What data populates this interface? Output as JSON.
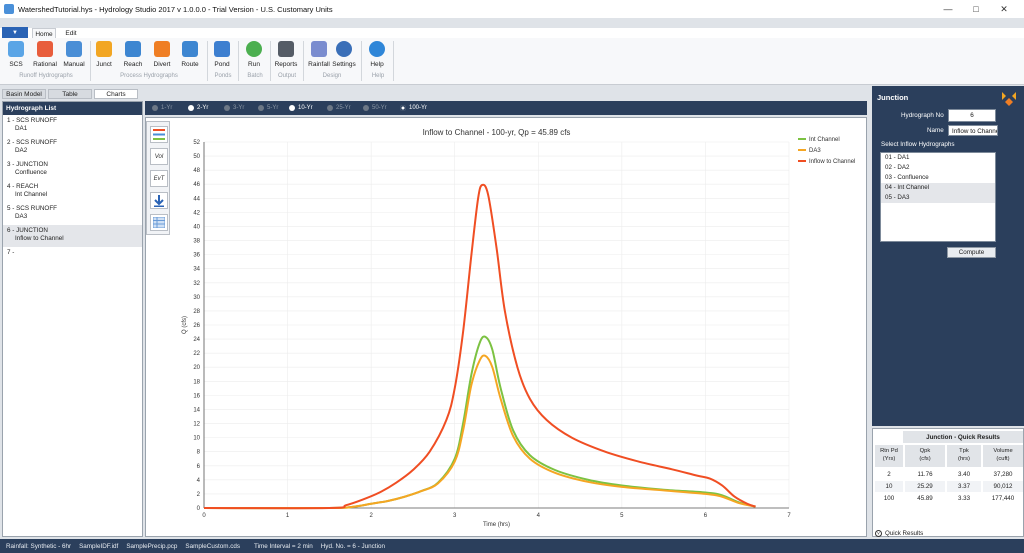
{
  "window": {
    "title": "WatershedTutorial.hys - Hydrology Studio 2017 v 1.0.0.0 - Trial Version - U.S. Customary Units"
  },
  "menu": {
    "tabs": [
      "Home",
      "Edit"
    ]
  },
  "ribbon": {
    "buttons": [
      {
        "label": "SCS",
        "icon": "scs-rain-icon"
      },
      {
        "label": "Rational",
        "icon": "rational-icon"
      },
      {
        "label": "Manual",
        "icon": "manual-icon"
      },
      {
        "label": "Junct",
        "icon": "junction-icon"
      },
      {
        "label": "Reach",
        "icon": "reach-icon"
      },
      {
        "label": "Divert",
        "icon": "divert-icon"
      },
      {
        "label": "Route",
        "icon": "route-icon"
      },
      {
        "label": "Pond",
        "icon": "pond-icon"
      },
      {
        "label": "Run",
        "icon": "run-icon"
      },
      {
        "label": "Reports",
        "icon": "printer-icon"
      },
      {
        "label": "Rainfall",
        "icon": "rainfall-icon"
      },
      {
        "label": "Settings",
        "icon": "gear-icon"
      },
      {
        "label": "Help",
        "icon": "help-icon"
      }
    ],
    "groups": [
      "Runoff Hydrographs",
      "Process Hydrographs",
      "Ponds",
      "Batch",
      "Output",
      "Design",
      "Help"
    ]
  },
  "views": {
    "tabs": [
      "Basin Model",
      "Table",
      "Charts"
    ],
    "active": "Charts"
  },
  "hydrograph_list": {
    "title": "Hydrograph List",
    "items": [
      {
        "line1": "1 - SCS RUNOFF",
        "line2": "DA1"
      },
      {
        "line1": "2 - SCS RUNOFF",
        "line2": "DA2"
      },
      {
        "line1": "3 - JUNCTION",
        "line2": "Confluence"
      },
      {
        "line1": "4 - REACH",
        "line2": "Int Channel"
      },
      {
        "line1": "5 - SCS RUNOFF",
        "line2": "DA3"
      },
      {
        "line1": "6 - JUNCTION",
        "line2": "Inflow to Channel"
      },
      {
        "line1": "7 -",
        "line2": ""
      }
    ],
    "selected_index": 5
  },
  "return_periods": {
    "options": [
      "1-Yr",
      "2-Yr",
      "3-Yr",
      "5-Yr",
      "10-Yr",
      "25-Yr",
      "50-Yr",
      "100-Yr"
    ],
    "enabled": [
      "2-Yr",
      "10-Yr",
      "100-Yr"
    ],
    "selected": "100-Yr"
  },
  "chart_tools": {
    "vol_label": "Vol",
    "evt_label": "EvT"
  },
  "chart_data": {
    "type": "line",
    "title": "Inflow to Channel - 100-yr, Qp = 45.89 cfs",
    "xlabel": "Time (hrs)",
    "ylabel": "Q (cfs)",
    "xlim": [
      0,
      7
    ],
    "ylim": [
      0,
      52
    ],
    "xticks": [
      0,
      1,
      2,
      3,
      4,
      5,
      6,
      7
    ],
    "yticks": [
      0,
      2,
      4,
      6,
      8,
      10,
      12,
      14,
      16,
      18,
      20,
      22,
      24,
      26,
      28,
      30,
      32,
      34,
      36,
      38,
      40,
      42,
      44,
      46,
      48,
      50,
      52
    ],
    "grid": true,
    "legend": "top-right",
    "series": [
      {
        "name": "Int Channel",
        "color": "#7cc242",
        "x": [
          0,
          1.5,
          1.8,
          2.0,
          2.2,
          2.4,
          2.6,
          2.8,
          3.0,
          3.1,
          3.2,
          3.3,
          3.37,
          3.45,
          3.55,
          3.7,
          3.9,
          4.2,
          4.6,
          5.0,
          5.5,
          6.0,
          6.2,
          6.4,
          6.6
        ],
        "y": [
          0,
          0,
          0.2,
          0.6,
          1.0,
          1.6,
          2.4,
          3.6,
          7.0,
          12.0,
          19.0,
          23.5,
          24.3,
          22.5,
          17.0,
          11.0,
          7.5,
          5.4,
          4.0,
          3.2,
          2.6,
          2.2,
          1.8,
          0.8,
          0.2
        ]
      },
      {
        "name": "DA3",
        "color": "#f5a623",
        "x": [
          0,
          1.5,
          1.8,
          2.0,
          2.2,
          2.4,
          2.6,
          2.8,
          3.0,
          3.1,
          3.2,
          3.3,
          3.37,
          3.45,
          3.55,
          3.7,
          3.9,
          4.2,
          4.6,
          5.0,
          5.5,
          6.0,
          6.2,
          6.4,
          6.6
        ],
        "y": [
          0,
          0,
          0.2,
          0.6,
          1.0,
          1.6,
          2.4,
          3.5,
          6.6,
          11.0,
          17.5,
          21.0,
          21.6,
          20.0,
          15.5,
          10.2,
          7.0,
          5.0,
          3.7,
          3.0,
          2.5,
          2.0,
          1.6,
          0.7,
          0.2
        ]
      },
      {
        "name": "Inflow to Channel",
        "color": "#f04e23",
        "x": [
          0,
          1.5,
          1.7,
          1.9,
          2.1,
          2.3,
          2.5,
          2.7,
          2.9,
          3.0,
          3.1,
          3.2,
          3.28,
          3.33,
          3.4,
          3.5,
          3.6,
          3.75,
          3.9,
          4.1,
          4.4,
          4.8,
          5.2,
          5.6,
          5.9,
          6.05,
          6.2,
          6.35,
          6.5,
          6.6
        ],
        "y": [
          0,
          0,
          0.4,
          1.2,
          2.2,
          3.6,
          5.4,
          8.0,
          12.5,
          17.0,
          25.0,
          36.0,
          44.0,
          45.9,
          44.5,
          37.0,
          28.0,
          20.0,
          15.5,
          12.5,
          10.0,
          8.0,
          6.6,
          5.5,
          4.6,
          4.2,
          3.2,
          1.6,
          0.6,
          0.2
        ]
      }
    ]
  },
  "junction": {
    "title": "Junction",
    "hydrograph_no_label": "Hydrograph No",
    "hydrograph_no": "6",
    "name_label": "Name",
    "name_value": "Inflow to Channel",
    "inflow_label": "Select Inflow Hydrographs",
    "inflow_items": [
      "01 - DA1",
      "02 - DA2",
      "03 - Confluence",
      "04 - Int Channel",
      "05 - DA3"
    ],
    "inflow_selected": [
      "04 - Int Channel",
      "05 - DA3"
    ],
    "compute_label": "Compute"
  },
  "quick_results": {
    "title": "Junction - Quick Results",
    "headers": [
      "Rtn Pd\n(Yrs)",
      "Qpk\n(cfs)",
      "Tpk\n(hrs)",
      "Volume\n(cuft)"
    ],
    "rows": [
      [
        "2",
        "11.76",
        "3.40",
        "37,280"
      ],
      [
        "10",
        "25.29",
        "3.37",
        "90,012"
      ],
      [
        "100",
        "45.89",
        "3.33",
        "177,440"
      ]
    ],
    "footer": "Quick Results"
  },
  "status": {
    "rainfall": "Rainfall:  Synthetic - 6hr",
    "idf": "SampleIDF.idf",
    "precip": "SamplePrecip.pcp",
    "custom": "SampleCustom.cds",
    "interval": "Time Interval = 2 min",
    "hyd": "Hyd. No. = 6 - Junction"
  },
  "colors": {
    "accent": "#2b3f5c",
    "file_button": "#2a63b5"
  }
}
